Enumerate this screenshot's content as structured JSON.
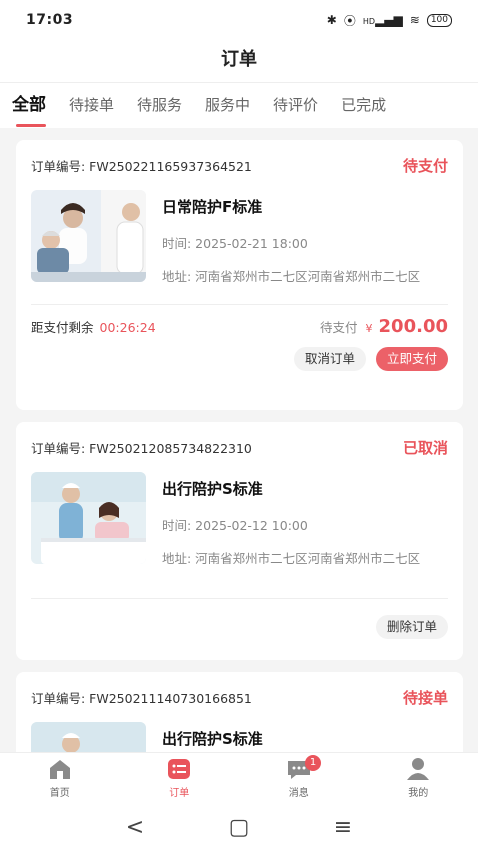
{
  "statusbar": {
    "time": "17:03",
    "battery": "100",
    "network": "HD"
  },
  "header": {
    "title": "订单"
  },
  "tabs": [
    {
      "label": "全部",
      "active": true
    },
    {
      "label": "待接单",
      "active": false
    },
    {
      "label": "待服务",
      "active": false
    },
    {
      "label": "服务中",
      "active": false
    },
    {
      "label": "待评价",
      "active": false
    },
    {
      "label": "已完成",
      "active": false
    }
  ],
  "orders": [
    {
      "order_no": "订单编号: FW250221165937364521",
      "status": "待支付",
      "service_name": "日常陪护F标准",
      "time": "时间: 2025-02-21 18:00",
      "address": "地址: 河南省郑州市二七区河南省郑州市二七区",
      "remaining_label": "距支付剩余",
      "countdown": "00:26:24",
      "due_label": "待支付",
      "currency": "¥",
      "amount": "200.00",
      "actions": [
        "取消订单",
        "立即支付"
      ]
    },
    {
      "order_no": "订单编号: FW250212085734822310",
      "status": "已取消",
      "service_name": "出行陪护S标准",
      "time": "时间: 2025-02-12 10:00",
      "address": "地址: 河南省郑州市二七区河南省郑州市二七区",
      "actions": [
        "删除订单"
      ]
    },
    {
      "order_no": "订单编号: FW250211140730166851",
      "status": "待接单",
      "service_name": "出行陪护S标准"
    }
  ],
  "tabbar": [
    {
      "label": "首页",
      "icon": "home-icon",
      "active": false
    },
    {
      "label": "订单",
      "icon": "order-icon",
      "active": true
    },
    {
      "label": "消息",
      "icon": "message-icon",
      "active": false,
      "badge": "1"
    },
    {
      "label": "我的",
      "icon": "profile-icon",
      "active": false
    }
  ],
  "colors": {
    "accent": "#e9545b",
    "background": "#f4f4f4"
  }
}
